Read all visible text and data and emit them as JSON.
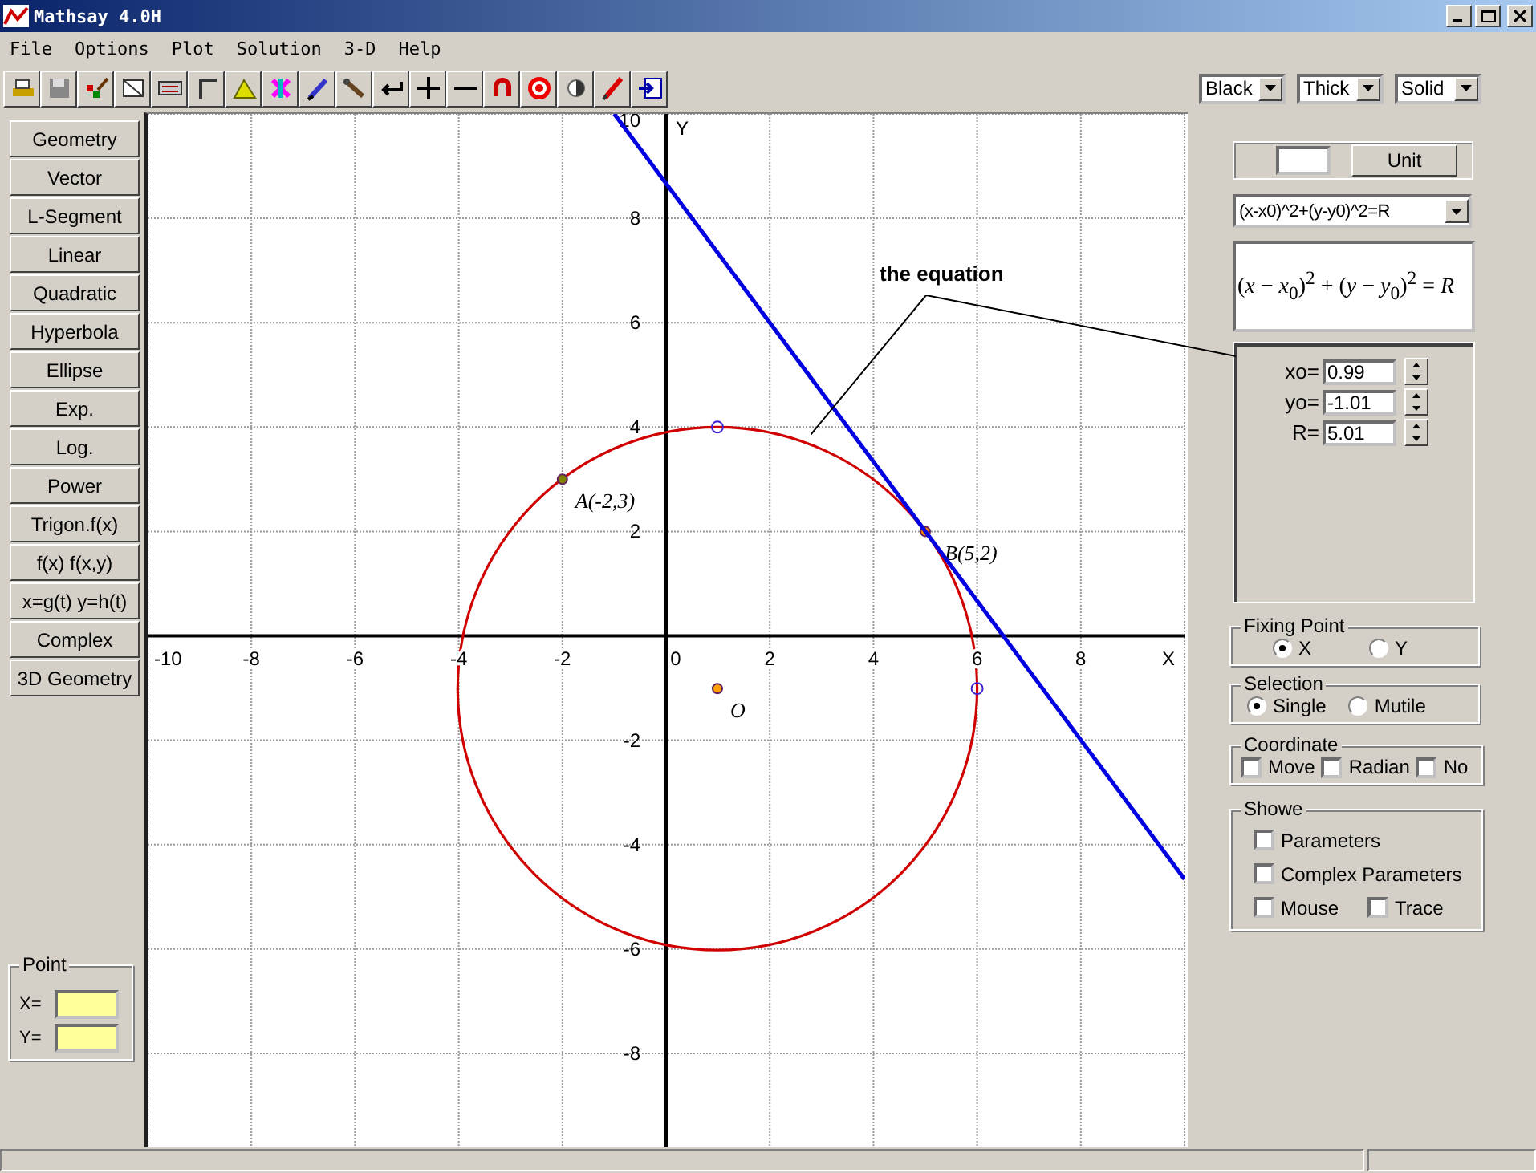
{
  "window": {
    "title": "Mathsay 4.0H"
  },
  "menu": [
    "File",
    "Options",
    "Plot",
    "Solution",
    "3-D",
    "Help"
  ],
  "toolbar_dropdowns": [
    {
      "value": "Black"
    },
    {
      "value": "Thick"
    },
    {
      "value": "Solid"
    }
  ],
  "categories": [
    "Geometry",
    "Vector",
    "L-Segment",
    "Linear",
    "Quadratic",
    "Hyperbola",
    "Ellipse",
    "Exp.",
    "Log.",
    "Power",
    "Trigon.f(x)",
    "f(x)  f(x,y)",
    "x=g(t) y=h(t)",
    "Complex",
    "3D Geometry"
  ],
  "point_panel": {
    "title": "Point",
    "fields": [
      {
        "label": "X="
      },
      {
        "label": "Y="
      }
    ]
  },
  "plot": {
    "annotation": "the equation",
    "chart_data": {
      "type": "scatter",
      "grid": true,
      "xlabel": "X",
      "ylabel": "Y",
      "xlim": [
        -10,
        10
      ],
      "ylim": [
        -9.8,
        10
      ],
      "xticks": [
        -10,
        -8,
        -6,
        -4,
        -2,
        0,
        2,
        4,
        6,
        8
      ],
      "yticks": [
        -8,
        -6,
        -4,
        -2,
        2,
        4,
        6,
        8,
        10
      ],
      "series": [
        {
          "name": "A(-2,3)",
          "color": "#808000",
          "x": [
            -2
          ],
          "values": [
            3
          ]
        },
        {
          "name": "B(5,2)",
          "color": "#ff8000",
          "x": [
            5
          ],
          "values": [
            2
          ]
        },
        {
          "name": "O",
          "color": "#ffa000",
          "x": [
            0.99
          ],
          "values": [
            -1.01
          ]
        },
        {
          "type": "line",
          "color": "#0000e0",
          "x": [
            -1.0,
            10
          ],
          "values": [
            10,
            -4.66
          ]
        }
      ]
    }
  },
  "unit": {
    "button": "Unit"
  },
  "equation_select": {
    "value": "(x-x0)^2+(y-y0)^2=R"
  },
  "equation_display": "(*x* − *x*$_{0}$)$^{2}$ + (*y* − *y*$_{0}$)$^{2}$ = *R*",
  "parameters": [
    {
      "label": "xo=",
      "value": "0.99"
    },
    {
      "label": "yo=",
      "value": "-1.01"
    },
    {
      "label": "R=",
      "value": "5.01"
    }
  ],
  "fixing_point": {
    "title": "Fixing Point",
    "options": [
      {
        "label": "X",
        "selected": true
      },
      {
        "label": "Y",
        "selected": false
      }
    ]
  },
  "selection": {
    "title": "Selection",
    "options": [
      {
        "label": "Single",
        "selected": true
      },
      {
        "label": "Mutile",
        "selected": false
      }
    ]
  },
  "coordinate": {
    "title": "Coordinate",
    "options": [
      {
        "label": "Move",
        "checked": false
      },
      {
        "label": "Radian",
        "checked": false
      },
      {
        "label": "No",
        "checked": false
      }
    ]
  },
  "showe": {
    "title": "Showe",
    "rows": [
      [
        {
          "label": "Parameters",
          "checked": false
        }
      ],
      [
        {
          "label": "Complex Parameters",
          "checked": false
        }
      ],
      [
        {
          "label": "Mouse",
          "checked": false
        },
        {
          "label": "Trace",
          "checked": false
        }
      ]
    ]
  }
}
